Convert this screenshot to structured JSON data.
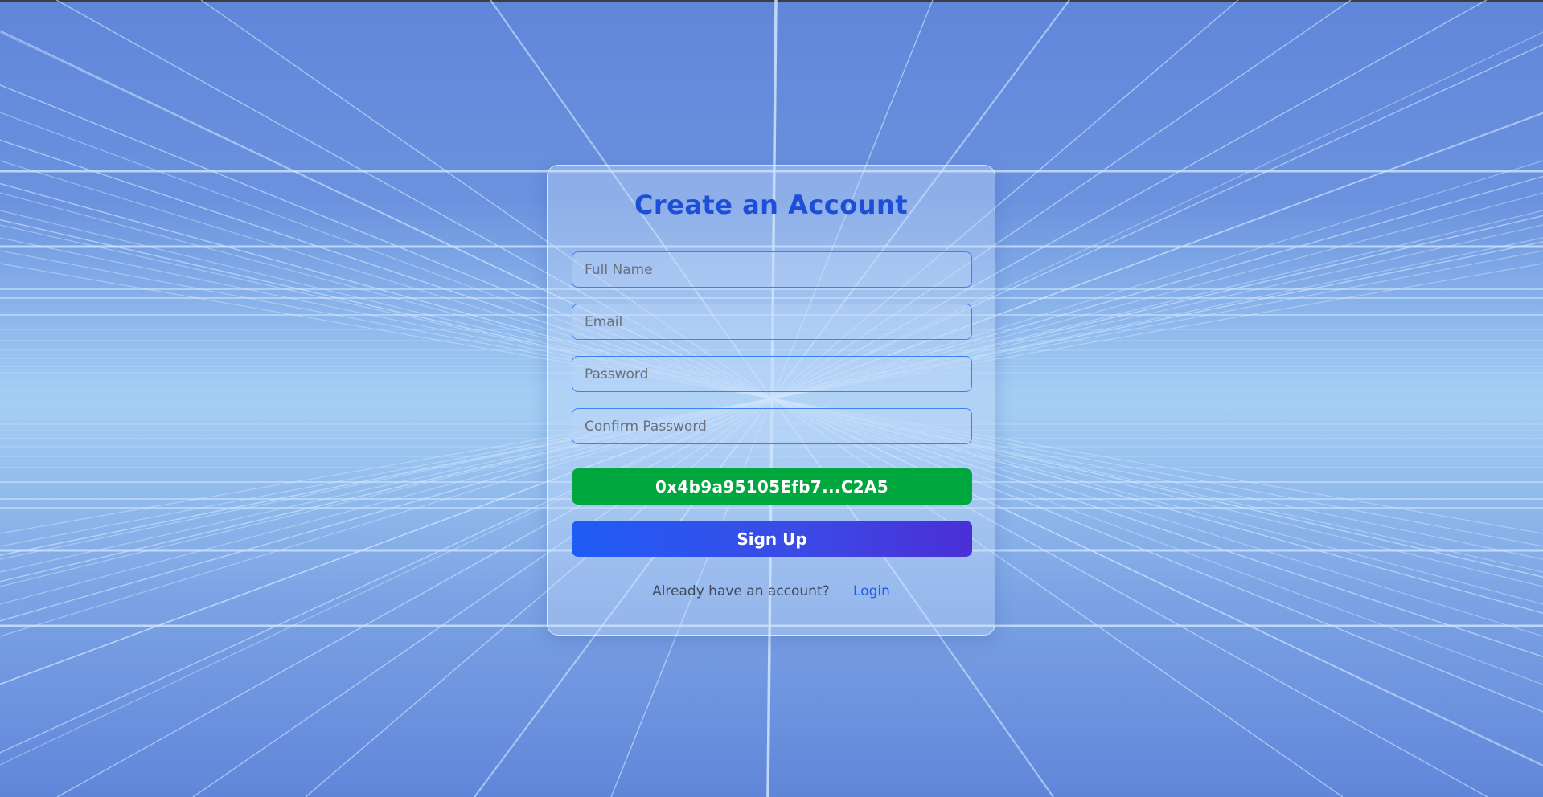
{
  "form": {
    "title": "Create an Account",
    "full_name_placeholder": "Full Name",
    "email_placeholder": "Email",
    "password_placeholder": "Password",
    "confirm_password_placeholder": "Confirm Password",
    "wallet_button_label": "0x4b9a95105Efb7...C2A5",
    "signup_button_label": "Sign Up",
    "login_prompt": "Already have an account?",
    "login_link_label": "Login"
  },
  "colors": {
    "title": "#1d4ed8",
    "wallet_button": "#00a63e",
    "signup_gradient_start": "#1e5cf5",
    "signup_gradient_end": "#4a2fd6",
    "link": "#1d5cf0",
    "field_border": "#3b82f6"
  }
}
